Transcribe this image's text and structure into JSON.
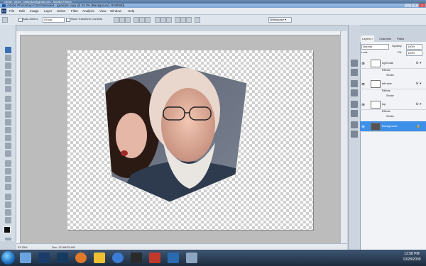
{
  "browser_tabs": "Gmail - Inbox - lesleyfun@gmail.com - Mozilla Firefox",
  "window": {
    "title": "Adobe Photoshop CS3 Extended - [grampa copy @ 33.3% (Background, RGB/8#)]",
    "min": "–",
    "max": "□",
    "close": "X"
  },
  "menu": {
    "logo": "Ps",
    "items": [
      "File",
      "Edit",
      "Image",
      "Layer",
      "Select",
      "Filter",
      "Analysis",
      "View",
      "Window",
      "Help"
    ]
  },
  "options": {
    "auto_select": "Auto-Select:",
    "group": "Group",
    "show_transform": "Show Transform Controls",
    "workspace": "Workspace ▾"
  },
  "status": {
    "zoom": "33.33%",
    "doc": "Doc: 12.0M/23.6M"
  },
  "layers_panel": {
    "tabs": [
      "Layers ×",
      "Channels",
      "Paths"
    ],
    "blend_mode": "Normal",
    "opacity_label": "Opacity:",
    "opacity": "100%",
    "lock_label": "Lock:",
    "fill_label": "Fill:",
    "fill": "100%",
    "layers": [
      {
        "name": "right side",
        "fx": "fx ▾",
        "effects": "Effects",
        "stroke": "Stroke"
      },
      {
        "name": "left side",
        "fx": "fx ▾",
        "effects": "Effects",
        "stroke": "Stroke"
      },
      {
        "name": "top",
        "fx": "fx ▾",
        "effects": "Effects",
        "stroke": "Stroke"
      },
      {
        "name": "Background"
      }
    ]
  },
  "clock": {
    "time": "12:58 PM",
    "date": "10/28/2009"
  },
  "colors": {
    "selection": "#3d8fe8",
    "taskbar": "#1d2c3e",
    "canvas_check": "#cfcfcf"
  }
}
